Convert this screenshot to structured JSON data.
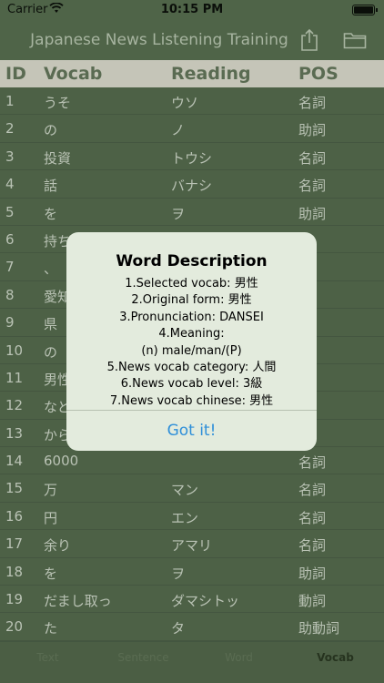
{
  "status_bar": {
    "carrier": "Carrier",
    "time": "10:15 PM"
  },
  "nav": {
    "title": "Japanese News Listening Training",
    "share_icon": "share-icon",
    "folder_icon": "folder-icon"
  },
  "table": {
    "headers": [
      "ID",
      "Vocab",
      "Reading",
      "POS"
    ],
    "rows": [
      [
        "1",
        "うそ",
        "ウソ",
        "名詞"
      ],
      [
        "2",
        "の",
        "ノ",
        "助詞"
      ],
      [
        "3",
        "投資",
        "トウシ",
        "名詞"
      ],
      [
        "4",
        "話",
        "バナシ",
        "名詞"
      ],
      [
        "5",
        "を",
        "ヲ",
        "助詞"
      ],
      [
        "6",
        "持ち",
        "",
        ""
      ],
      [
        "7",
        "、",
        "",
        ""
      ],
      [
        "8",
        "愛知",
        "",
        ""
      ],
      [
        "9",
        "県",
        "",
        ""
      ],
      [
        "10",
        "の",
        "",
        ""
      ],
      [
        "11",
        "男性",
        "",
        ""
      ],
      [
        "12",
        "など",
        "",
        ""
      ],
      [
        "13",
        "から",
        "",
        ""
      ],
      [
        "14",
        "6000",
        "",
        "名詞"
      ],
      [
        "15",
        "万",
        "マン",
        "名詞"
      ],
      [
        "16",
        "円",
        "エン",
        "名詞"
      ],
      [
        "17",
        "余り",
        "アマリ",
        "名詞"
      ],
      [
        "18",
        "を",
        "ヲ",
        "助詞"
      ],
      [
        "19",
        "だまし取っ",
        "ダマシトッ",
        "動詞"
      ],
      [
        "20",
        "た",
        "タ",
        "助動詞"
      ]
    ]
  },
  "tabs": [
    "Text",
    "Sentence",
    "Word",
    "Vocab"
  ],
  "alert": {
    "title": "Word Description",
    "lines": [
      "1.Selected vocab: 男性",
      "2.Original form: 男性",
      "3.Pronunciation: DANSEI",
      "4.Meaning:",
      "(n) male/man/(P)",
      "5.News vocab category: 人間",
      "6.News vocab level: 3級",
      "7.News vocab chinese: 男性"
    ],
    "button": "Got it!"
  },
  "colors": {
    "accent": "#2f8fd9",
    "background": "#4d6146",
    "header": "#c5c5b8"
  }
}
